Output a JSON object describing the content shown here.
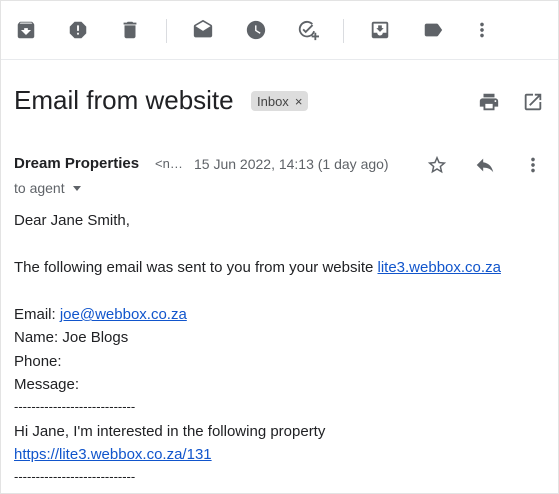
{
  "toolbar": {
    "icons": [
      "archive-icon",
      "report-spam-icon",
      "delete-icon",
      "mark-unread-icon",
      "snooze-icon",
      "add-to-tasks-icon",
      "move-to-icon",
      "label-icon",
      "more-vert-icon"
    ]
  },
  "email": {
    "subject": "Email from website",
    "label": "Inbox",
    "label_remove": "×",
    "sender_name": "Dream Properties",
    "sender_email_truncated": "<n…",
    "date": "15 Jun 2022, 14:13 (1 day ago)",
    "to": "to agent"
  },
  "body": {
    "greeting": "Dear Jane Smith,",
    "intro": "The following email was sent to you from your website ",
    "website_link": "lite3.webbox.co.za",
    "email_label": "Email: ",
    "email_link": "joe@webbox.co.za",
    "name_line": "Name: Joe Blogs",
    "phone_line": "Phone:",
    "message_line": "Message:",
    "divider": "----------------------------",
    "message": "Hi Jane, I'm interested in the following property",
    "property_link": "https://lite3.webbox.co.za/131",
    "divider2": "----------------------------"
  },
  "colors": {
    "icon": "#5f6368",
    "link": "#1155cc",
    "chip_bg": "#dddddd"
  }
}
